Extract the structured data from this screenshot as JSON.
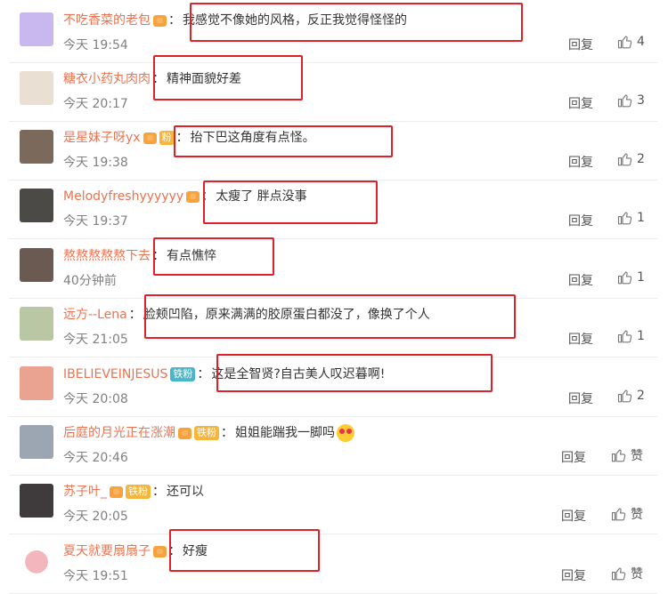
{
  "reply_label": "回复",
  "comments": [
    {
      "user": "不吃香菜的老包",
      "badge": true,
      "fan": "",
      "text": "我感觉不像她的风格，反正我觉得怪怪的",
      "time": "今天 19:54",
      "likes": "4",
      "emoji": false
    },
    {
      "user": "糖衣小药丸肉肉",
      "badge": false,
      "fan": "",
      "text": "精神面貌好差",
      "time": "今天 20:17",
      "likes": "3",
      "emoji": false
    },
    {
      "user": "是星妹子呀yx",
      "badge": true,
      "fan": "粉",
      "text": "抬下巴这角度有点怪。",
      "time": "今天 19:38",
      "likes": "2",
      "emoji": false
    },
    {
      "user": "Melodyfreshyyyyyy",
      "badge": true,
      "fan": "",
      "text": "太瘦了 胖点没事",
      "time": "今天 19:37",
      "likes": "1",
      "emoji": false
    },
    {
      "user": "熬熬熬熬熬下去",
      "badge": false,
      "fan": "",
      "text": "有点憔悴",
      "time": "40分钟前",
      "likes": "1",
      "emoji": false
    },
    {
      "user": "远方--Lena",
      "badge": false,
      "fan": "",
      "text": "脸颊凹陷，原来满满的胶原蛋白都没了，像换了个人",
      "time": "今天 21:05",
      "likes": "1",
      "emoji": false
    },
    {
      "user": "IBELIEVEINJESUS",
      "badge": false,
      "fan": "铁粉",
      "text": "这是全智贤?自古美人叹迟暮啊!",
      "time": "今天 20:08",
      "likes": "2",
      "emoji": false
    },
    {
      "user": "后庭的月光正在涨潮",
      "badge": true,
      "fan": "铁粉",
      "text": "姐姐能踹我一脚吗",
      "time": "今天 20:46",
      "likes": "赞",
      "emoji": true
    },
    {
      "user": "苏子叶_",
      "badge": true,
      "fan": "铁粉",
      "text": "还可以",
      "time": "今天 20:05",
      "likes": "赞",
      "emoji": false
    },
    {
      "user": "夏天就要扇扇子",
      "badge": true,
      "fan": "",
      "text": "好瘦",
      "time": "今天 19:51",
      "likes": "赞",
      "emoji": false
    }
  ]
}
